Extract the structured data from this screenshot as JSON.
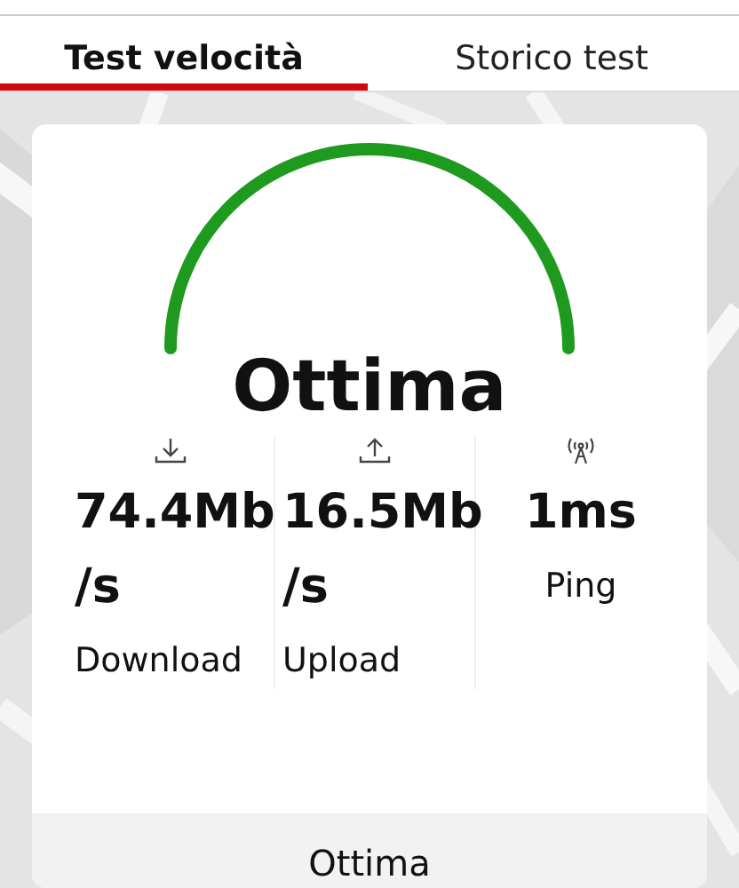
{
  "tabs": [
    {
      "label": "Test velocità",
      "selected": true
    },
    {
      "label": "Storico test",
      "selected": false
    }
  ],
  "result": {
    "rating": "Ottima",
    "metrics": [
      {
        "kind": "download",
        "value": "74.4Mb /s",
        "label": "Download"
      },
      {
        "kind": "upload",
        "value": "16.5Mb /s",
        "label": "Upload"
      },
      {
        "kind": "ping",
        "value": "1ms",
        "label": "Ping"
      }
    ],
    "footer_button": "Ottima"
  }
}
